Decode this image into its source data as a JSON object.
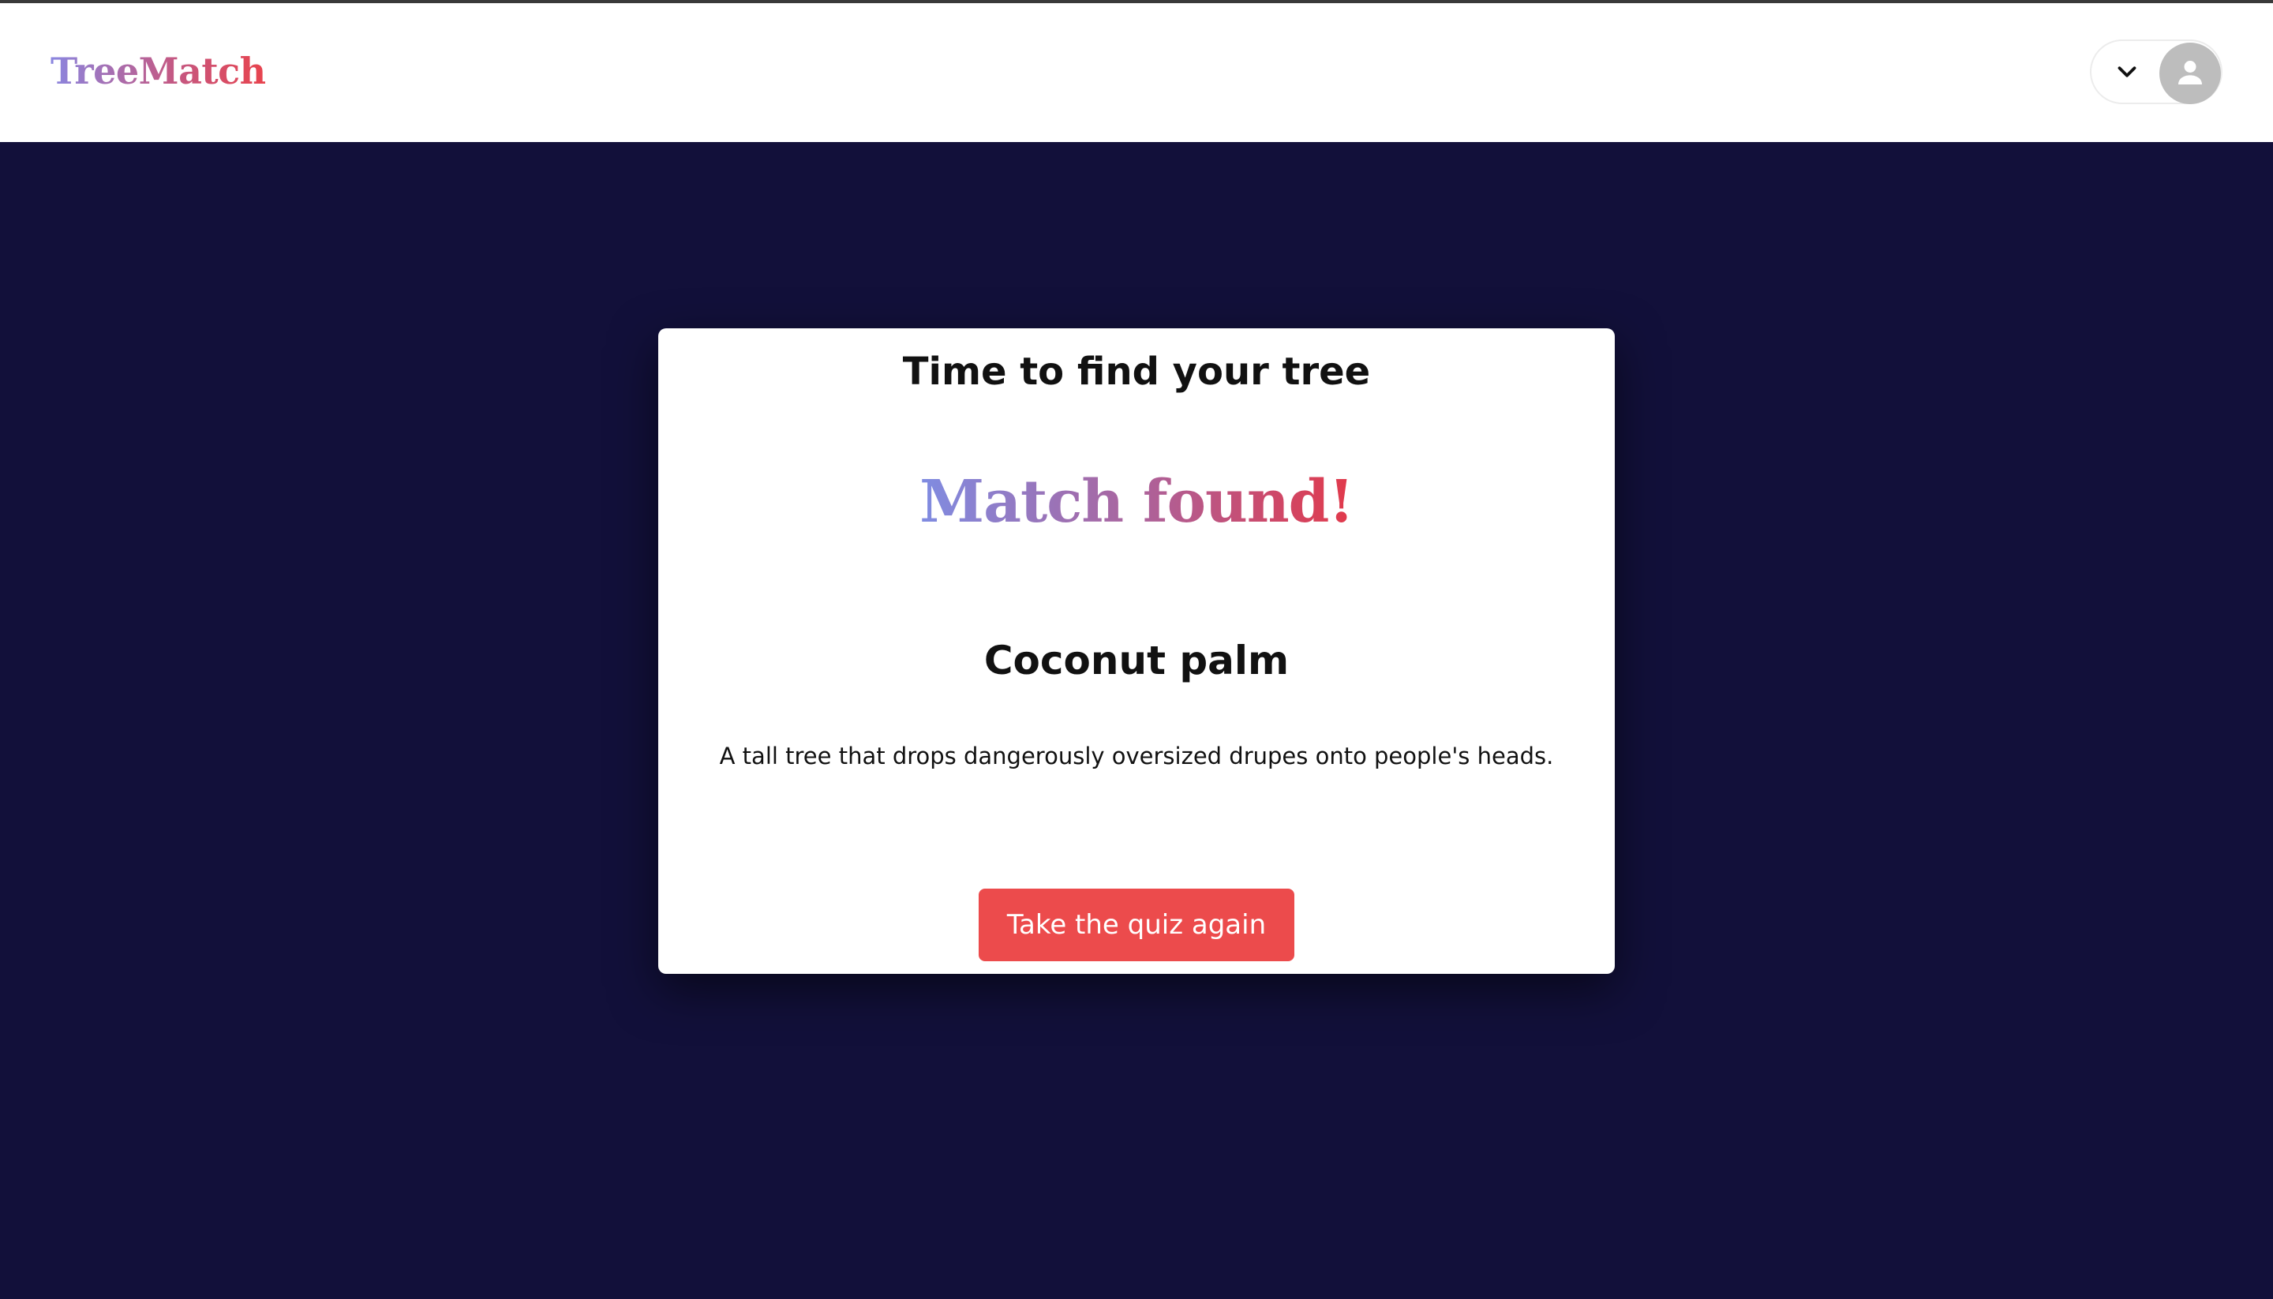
{
  "header": {
    "brand": "TreeMatch",
    "menu_icon": "chevron-down-icon",
    "avatar_icon": "user-icon"
  },
  "card": {
    "title": "Time to find your tree",
    "match_heading": "Match found!",
    "tree_name": "Coconut palm",
    "tree_description": "A tall tree that drops dangerously oversized drupes onto people's heads.",
    "retake_button_label": "Take the quiz again"
  },
  "colors": {
    "page_background": "#12103a",
    "button_background": "#ec4b4c",
    "brand_gradient_start": "#8a86e0",
    "brand_gradient_end": "#e8434d"
  }
}
